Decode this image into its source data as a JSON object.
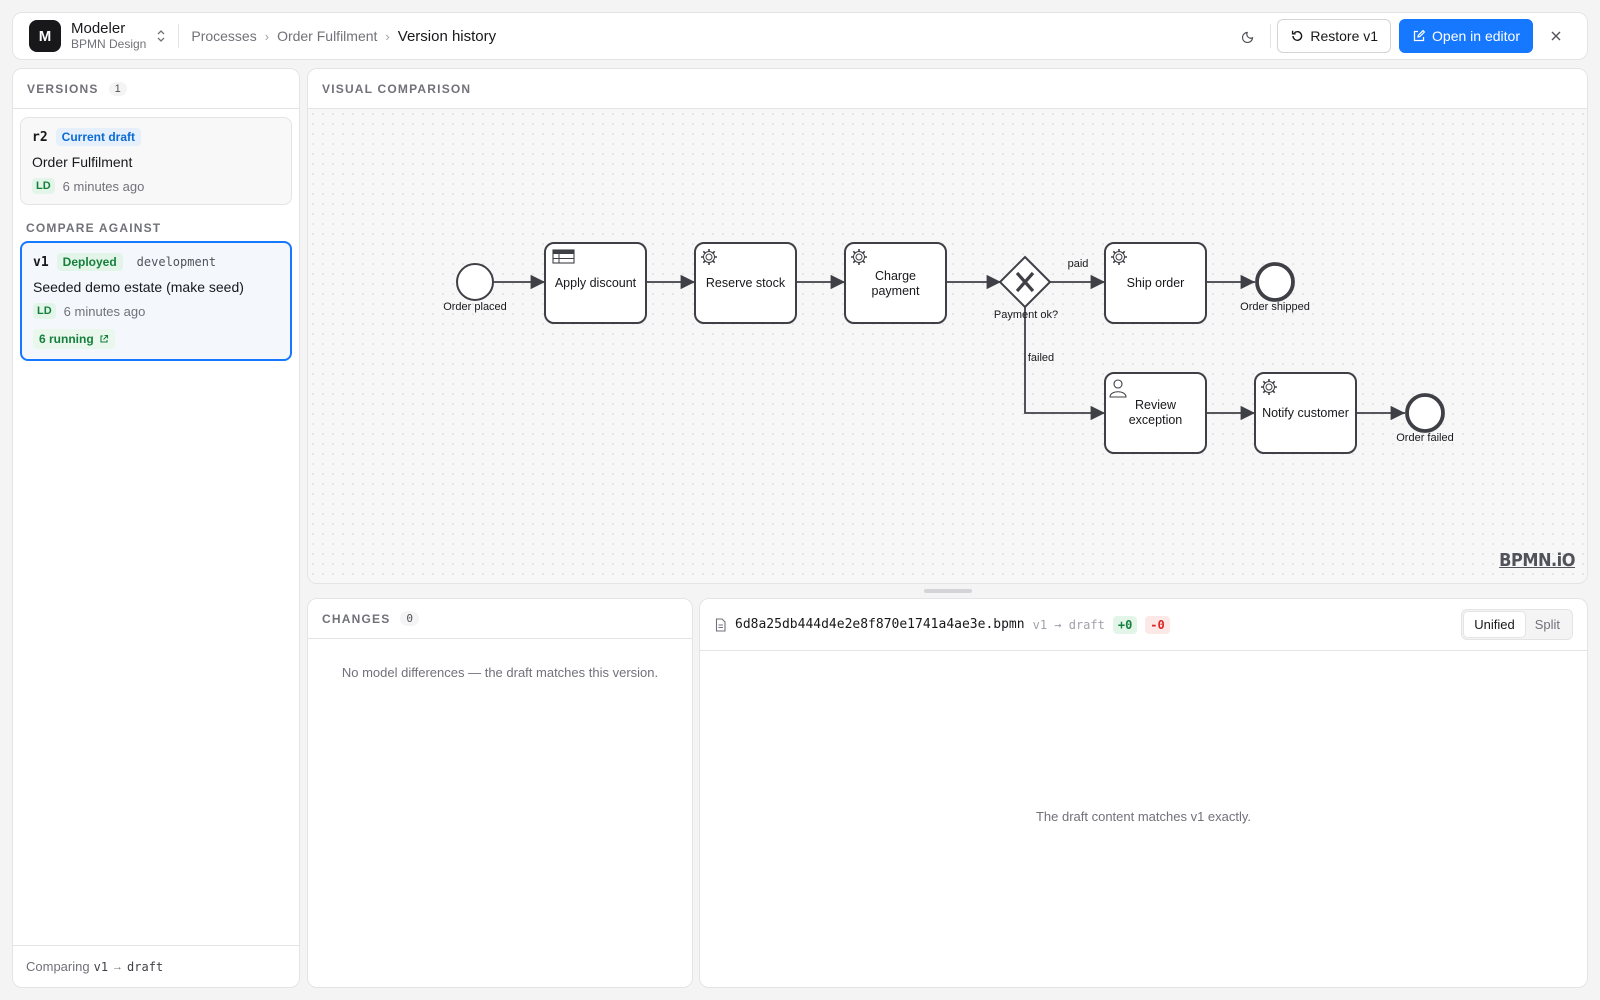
{
  "app": {
    "logo_letter": "M",
    "name": "Modeler",
    "subtitle": "BPMN Design"
  },
  "breadcrumb": {
    "items": [
      "Processes",
      "Order Fulfilment"
    ],
    "current": "Version history"
  },
  "header_actions": {
    "restore_label": "Restore v1",
    "open_editor_label": "Open in editor"
  },
  "colors": {
    "primary": "#1677ff",
    "deployed": "#15803d",
    "draft": "#0b6bd3"
  },
  "versions": {
    "title": "VERSIONS",
    "count": "1",
    "current": {
      "id": "r2",
      "badge": "Current draft",
      "title": "Order Fulfilment",
      "author": "LD",
      "time": "6 minutes ago"
    },
    "compare_label": "COMPARE AGAINST",
    "compare": {
      "id": "v1",
      "badge": "Deployed",
      "env": "development",
      "title": "Seeded demo estate (make seed)",
      "author": "LD",
      "time": "6 minutes ago",
      "running": "6 running"
    },
    "footer": {
      "prefix": "Comparing",
      "from": "v1",
      "arrow": "→",
      "to": "draft"
    }
  },
  "visual": {
    "title": "VISUAL COMPARISON",
    "watermark": "BPMN.iO",
    "diagram": {
      "start_event": "Order placed",
      "task_apply_discount": "Apply discount",
      "task_reserve_stock": "Reserve stock",
      "task_charge_payment": [
        "Charge",
        "payment"
      ],
      "gateway": "Payment ok?",
      "flow_paid": "paid",
      "flow_failed": "failed",
      "task_ship_order": "Ship order",
      "end_shipped": "Order shipped",
      "task_review_exception": [
        "Review",
        "exception"
      ],
      "task_notify_customer": "Notify customer",
      "end_failed": "Order failed"
    }
  },
  "changes": {
    "title": "CHANGES",
    "count": "0",
    "empty": "No model differences — the draft matches this version."
  },
  "diff": {
    "filename": "6d8a25db444d4e2e8f870e1741a4ae3e.bpmn",
    "range": "v1 → draft",
    "added": "+0",
    "removed": "-0",
    "mode_unified": "Unified",
    "mode_split": "Split",
    "empty": "The draft content matches v1 exactly."
  }
}
